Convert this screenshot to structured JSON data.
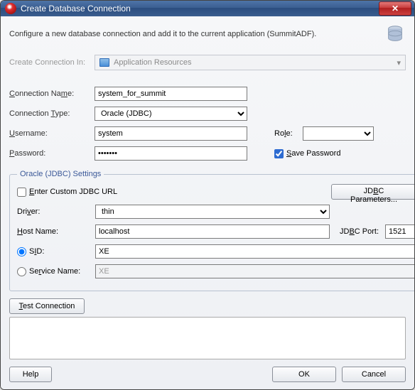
{
  "titlebar": {
    "title": "Create Database Connection"
  },
  "description": "Configure a new database connection and add it to the current application (SummitADF).",
  "create_in": {
    "label": "Create Connection In:",
    "value": "Application Resources"
  },
  "fields": {
    "connection_name_label": "Connection Name:",
    "connection_name_value": "system_for_summit",
    "connection_type_label": "Connection Type:",
    "connection_type_value": "Oracle (JDBC)",
    "username_label": "Username:",
    "username_value": "system",
    "password_label": "Password:",
    "password_value": "•••••••",
    "role_label": "Role:",
    "role_value": "",
    "save_password_label": "Save Password"
  },
  "settings": {
    "legend": "Oracle (JDBC) Settings",
    "custom_url_label": "Enter Custom JDBC URL",
    "jdbc_params_btn": "JDBC Parameters...",
    "driver_label": "Driver:",
    "driver_value": "thin",
    "host_label": "Host Name:",
    "host_value": "localhost",
    "jdbc_port_label": "JDBC Port:",
    "jdbc_port_value": "1521",
    "sid_label": "SID:",
    "sid_value": "XE",
    "service_label": "Service Name:",
    "service_value": "XE"
  },
  "actions": {
    "test_connection": "Test Connection",
    "help": "Help",
    "ok": "OK",
    "cancel": "Cancel"
  }
}
